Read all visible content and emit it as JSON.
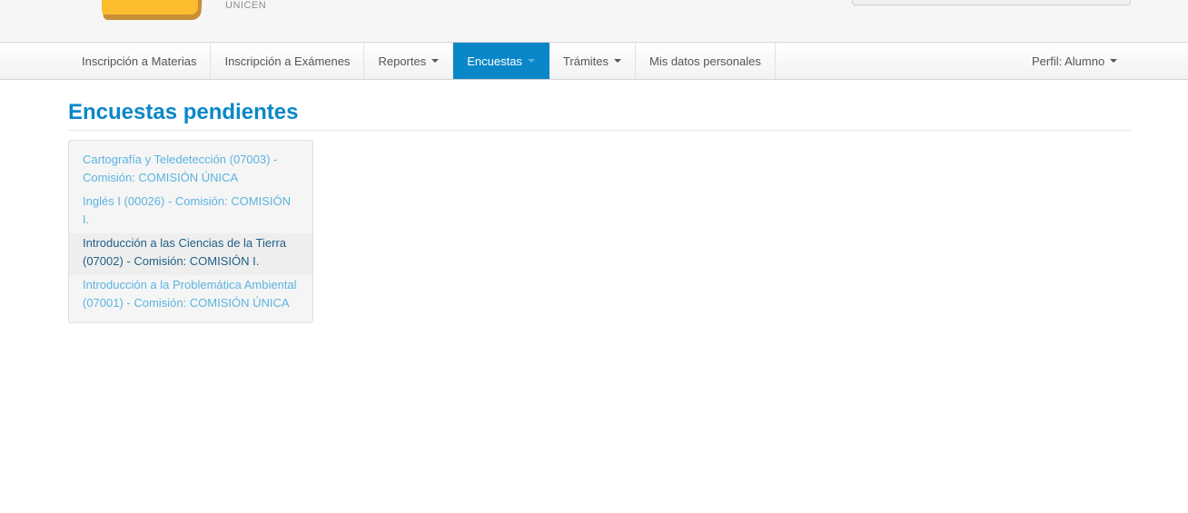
{
  "header": {
    "brand_sub": "UNICEN"
  },
  "nav": {
    "items": [
      {
        "label": "Inscripción a Materias",
        "dropdown": false
      },
      {
        "label": "Inscripción a Exámenes",
        "dropdown": false
      },
      {
        "label": "Reportes",
        "dropdown": true
      },
      {
        "label": "Encuestas",
        "dropdown": true,
        "active": true
      },
      {
        "label": "Trámites",
        "dropdown": true
      },
      {
        "label": "Mis datos personales",
        "dropdown": false
      }
    ],
    "profile_label": "Perfil: Alumno"
  },
  "main": {
    "title": "Encuestas pendientes",
    "surveys": [
      {
        "label": "Cartografía y Teledetección (07003) - Comisión: COMISIÓN ÚNICA"
      },
      {
        "label": "Inglés I (00026) - Comisión: COMISIÓN I."
      },
      {
        "label": "Introducción a las Ciencias de la Tierra (07002) - Comisión: COMISIÓN I.",
        "active": true
      },
      {
        "label": "Introducción a la Problemática Ambiental (07001) - Comisión: COMISIÓN ÚNICA"
      }
    ]
  },
  "colors": {
    "accent": "#0a87c9",
    "link": "#5bb4e0",
    "logo": "#fbbd2e"
  }
}
